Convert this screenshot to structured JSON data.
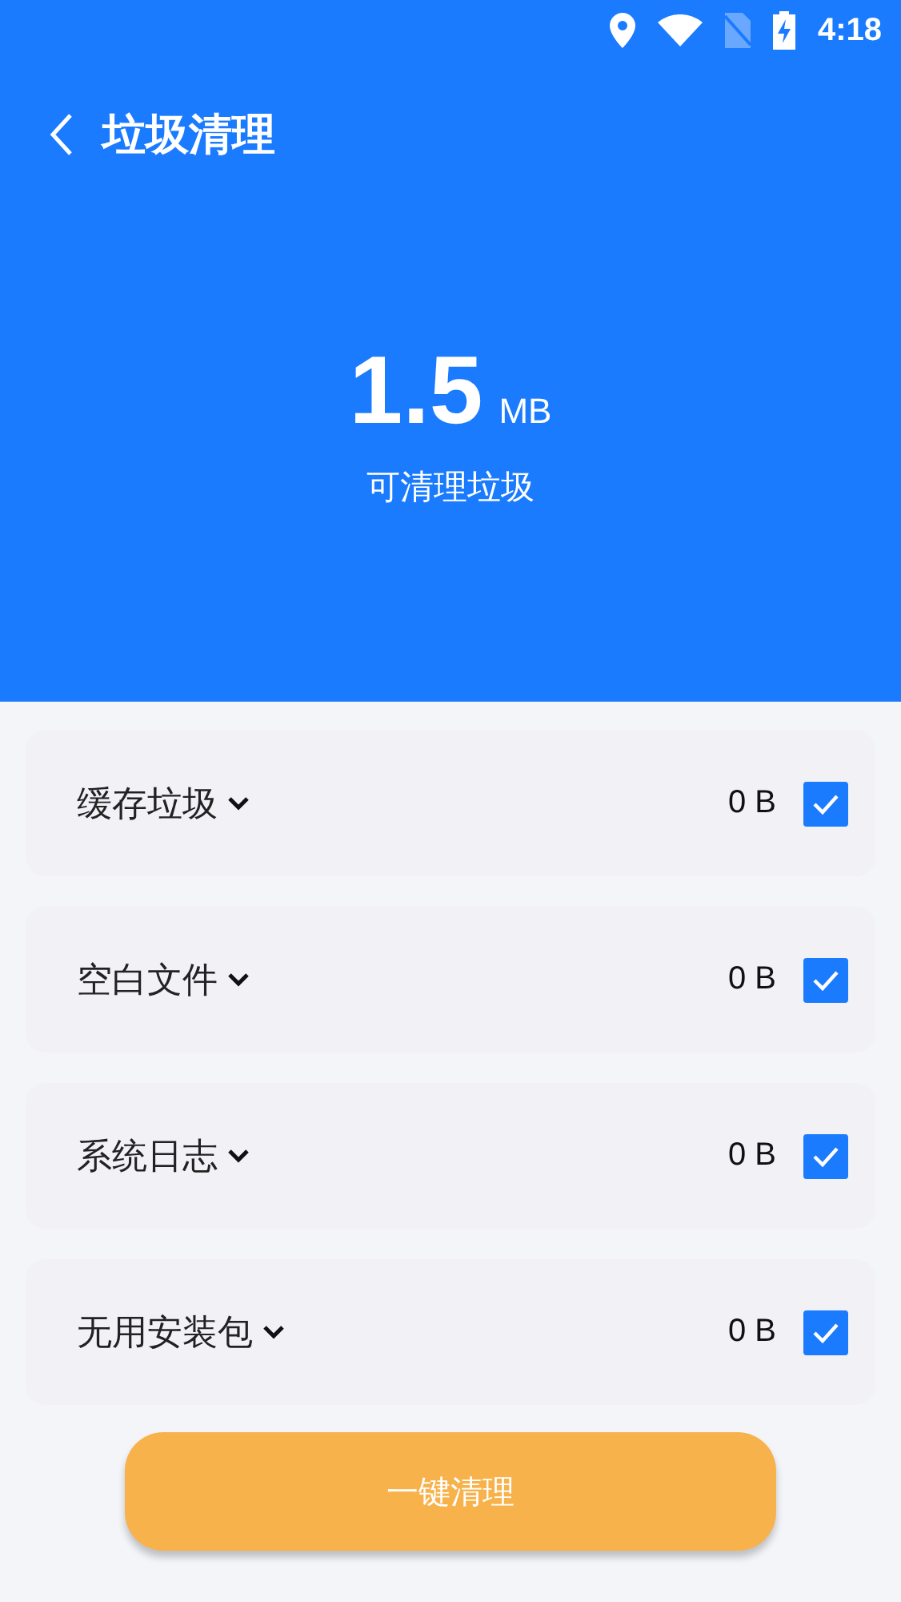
{
  "status_bar": {
    "time": "4:18"
  },
  "header": {
    "title": "垃圾清理"
  },
  "summary": {
    "size": "1.5",
    "unit": "MB",
    "label": "可清理垃圾"
  },
  "items": [
    {
      "name": "缓存垃圾",
      "size": "0 B",
      "checked": true
    },
    {
      "name": "空白文件",
      "size": "0 B",
      "checked": true
    },
    {
      "name": "系统日志",
      "size": "0 B",
      "checked": true
    },
    {
      "name": "无用安装包",
      "size": "0 B",
      "checked": true
    }
  ],
  "button": {
    "label": "一键清理"
  }
}
